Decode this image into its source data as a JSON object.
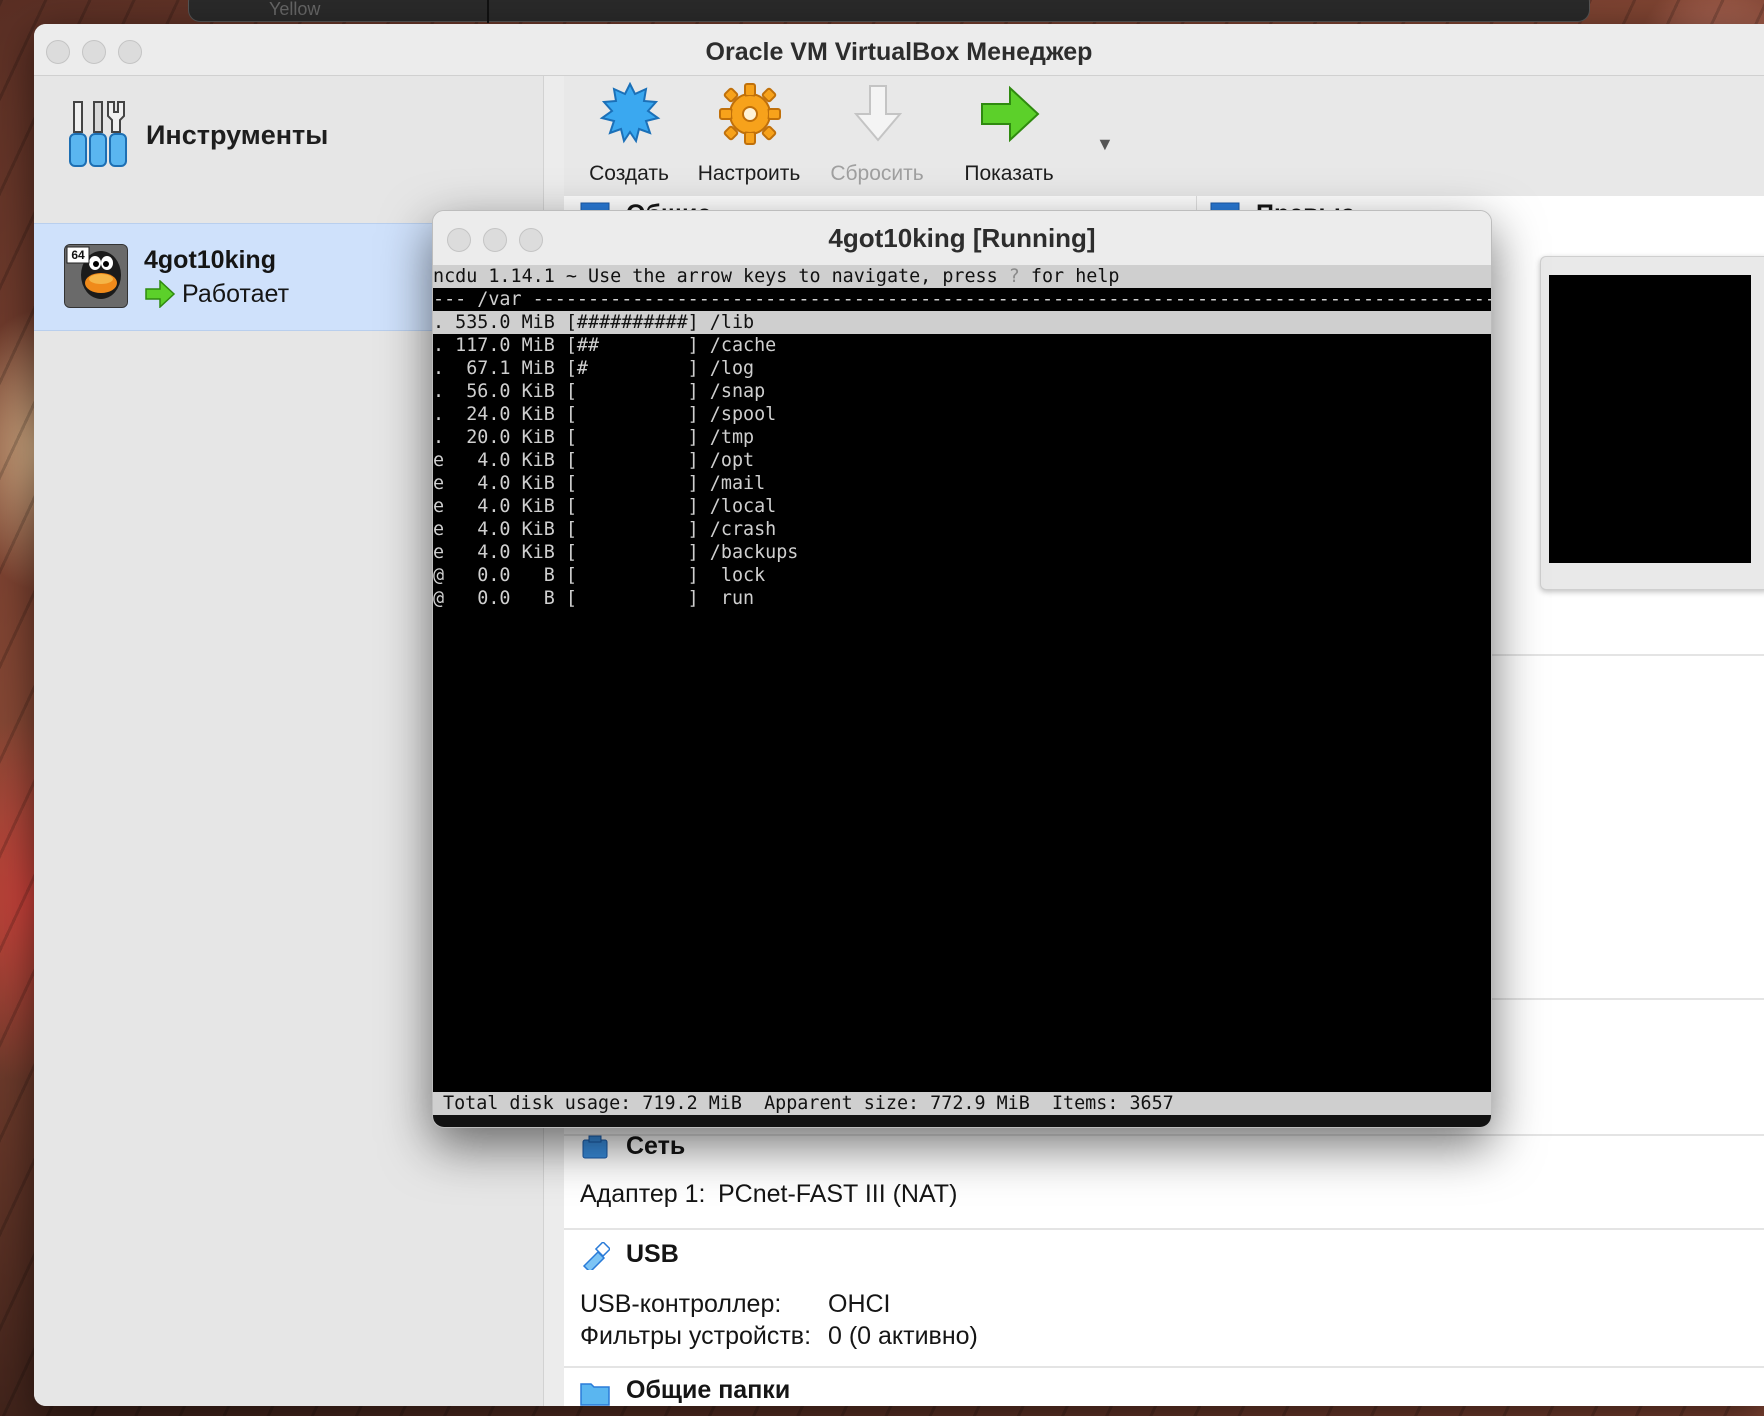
{
  "app": {
    "window_title": "Oracle VM VirtualBox Менеджер",
    "background_window_text": "Yellow"
  },
  "sidebar": {
    "tools_label": "Инструменты",
    "vm": {
      "name": "4got10king",
      "status": "Работает",
      "badge": "64"
    }
  },
  "toolbar": {
    "buttons": [
      {
        "label": "Создать",
        "icon": "create-icon",
        "enabled": true
      },
      {
        "label": "Настроить",
        "icon": "settings-icon",
        "enabled": true
      },
      {
        "label": "Сбросить",
        "icon": "discard-icon",
        "enabled": false
      },
      {
        "label": "Показать",
        "icon": "show-icon",
        "enabled": true
      }
    ],
    "caret": "▼"
  },
  "details": {
    "general_head": "Общие",
    "preview_head": "Превью",
    "network": {
      "head": "Сеть",
      "adapter_label": "Адаптер 1:",
      "adapter_value": "PCnet-FAST III (NAT)"
    },
    "usb": {
      "head": "USB",
      "controller_label": "USB-контроллер:",
      "controller_value": "OHCI",
      "filters_label": "Фильтры устройств:",
      "filters_value": "0 (0 активно)"
    },
    "shared_folders_head": "Общие папки"
  },
  "vm_window": {
    "title": "4got10king [Running]",
    "terminal": {
      "header_pre": "ncdu 1.14.1 ~ Use the arrow keys to navigate, press ",
      "header_q": "?",
      "header_post": " for help",
      "path_line": "--- /var -------------------------------------------------------------------------------------------------------------------",
      "rows": [
        ". 535.0 MiB [##########] /lib",
        ". 117.0 MiB [##        ] /cache",
        ".  67.1 MiB [#         ] /log",
        ".  56.0 KiB [          ] /snap",
        ".  24.0 KiB [          ] /spool",
        ".  20.0 KiB [          ] /tmp",
        "e   4.0 KiB [          ] /opt",
        "e   4.0 KiB [          ] /mail",
        "e   4.0 KiB [          ] /local",
        "e   4.0 KiB [          ] /crash",
        "e   4.0 KiB [          ] /backups",
        "@   0.0   B [          ]  lock",
        "@   0.0   B [          ]  run"
      ],
      "status": "Total disk usage: 719.2 MiB  Apparent size: 772.9 MiB  Items: 3657"
    }
  }
}
